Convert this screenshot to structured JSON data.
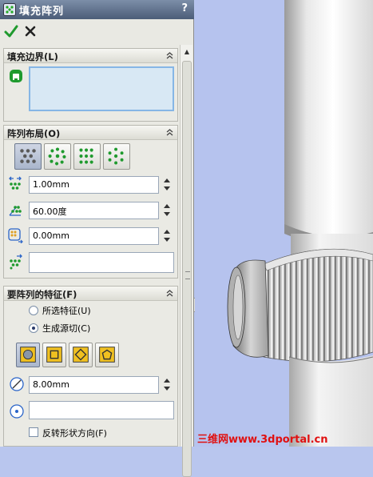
{
  "window": {
    "title": "填充阵列",
    "help": "?",
    "title_icon": "fill-pattern-icon"
  },
  "actions": {
    "ok_icon": "check-icon",
    "cancel_icon": "x-icon"
  },
  "groups": {
    "fill_boundary": {
      "label": "填充边界(L)",
      "selection_value": ""
    },
    "pattern_layout": {
      "label": "阵列布局(O)",
      "layout_buttons": [
        {
          "name": "perforation",
          "selected": true
        },
        {
          "name": "circular",
          "selected": false
        },
        {
          "name": "square",
          "selected": false
        },
        {
          "name": "polygon",
          "selected": false
        }
      ],
      "instance_spacing": "1.00mm",
      "stagger_angle": "60.00度",
      "margins": "0.00mm",
      "direction_value": ""
    },
    "features_to_pattern": {
      "label": "要阵列的特征(F)",
      "option_selected": "所选特征(U)",
      "option_create_cut": "生成源切(C)",
      "create_cut_checked": true,
      "shape_buttons": [
        {
          "name": "circle",
          "selected": true
        },
        {
          "name": "square",
          "selected": false
        },
        {
          "name": "diamond",
          "selected": false
        },
        {
          "name": "polygon",
          "selected": false
        }
      ],
      "diameter": "8.00mm",
      "vertex_value": "",
      "flip_label": "反转形状方向(F)",
      "flip_checked": false
    }
  },
  "watermark": "三维网www.3dportal.cn",
  "colors": {
    "accent_green": "#1f9a2e",
    "watermark_red": "#e01010",
    "viewport_bg": "#b6c3ee"
  }
}
